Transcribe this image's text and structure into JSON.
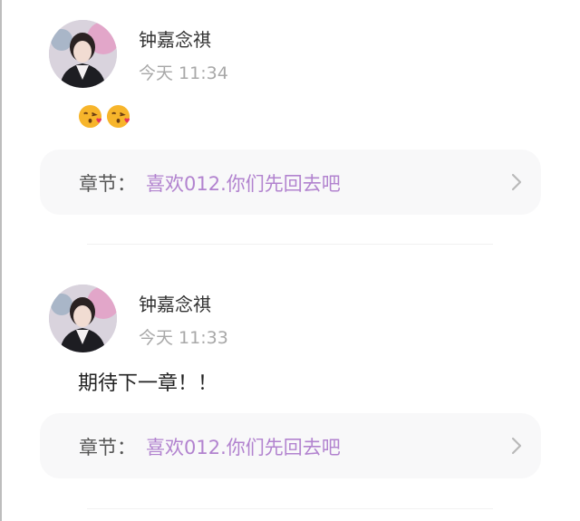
{
  "comments": [
    {
      "username": "钟嘉念祺",
      "time": "今天 11:34",
      "content_emojis": [
        "kissing-heart-emoji",
        "kissing-heart-emoji"
      ],
      "chapter": {
        "label": "章节：",
        "title": "喜欢012.你们先回去吧"
      }
    },
    {
      "username": "钟嘉念祺",
      "time": "今天 11:33",
      "content_text": "期待下一章！！",
      "chapter": {
        "label": "章节：",
        "title": "喜欢012.你们先回去吧"
      }
    }
  ],
  "colors": {
    "chapter_title": "#b283cf",
    "timestamp": "#a8a8a8",
    "card_background": "#f8f8f9"
  }
}
